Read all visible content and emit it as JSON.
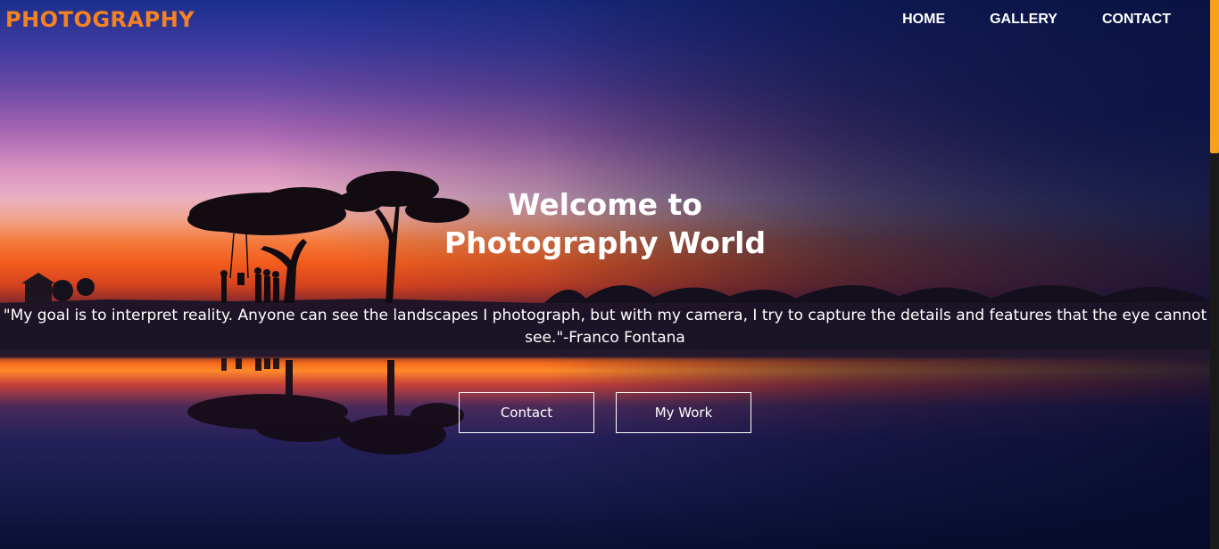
{
  "brand": {
    "logo": "PHOTOGRAPHY"
  },
  "nav": {
    "items": [
      {
        "label": "HOME"
      },
      {
        "label": "GALLERY"
      },
      {
        "label": "CONTACT"
      }
    ]
  },
  "hero": {
    "title_line1": "Welcome to",
    "title_line2": "Photography World",
    "quote": "\"My goal is to interpret reality. Anyone can see the landscapes I photograph, but with my camera, I try to capture the details and features that the eye cannot see.\"-Franco Fontana",
    "buttons": {
      "contact": "Contact",
      "work": "My Work"
    }
  },
  "colors": {
    "logo": "#f58220",
    "scroll_thumb": "#f5a11b",
    "text": "#ffffff"
  }
}
